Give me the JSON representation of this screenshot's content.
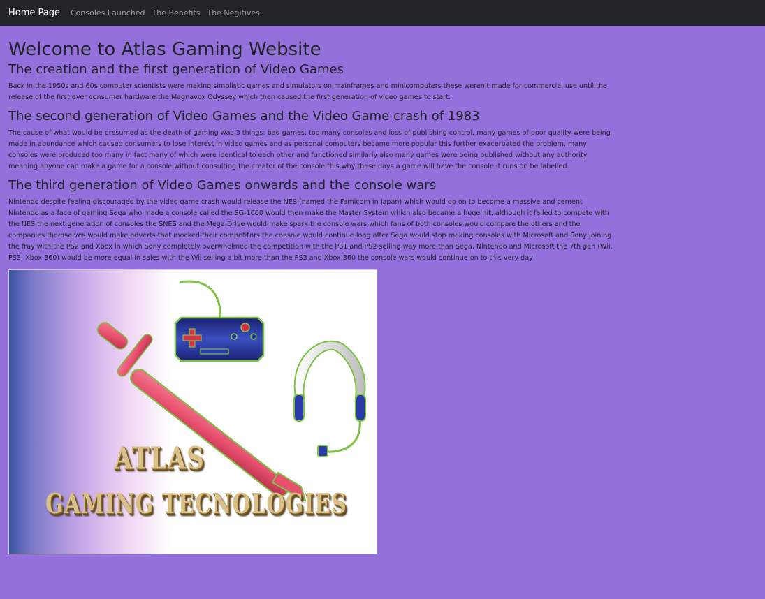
{
  "navbar": {
    "brand": "Home Page",
    "links": [
      "Consoles Launched",
      "The Benefits",
      "The Negitives"
    ]
  },
  "main": {
    "title": "Welcome to Atlas Gaming Website",
    "sections": [
      {
        "heading": "The creation and the first generation of Video Games",
        "body": "Back in the 1950s and 60s computer scientists were making simplistic games and simulators on mainframes and minicomputers these weren't made for commercial use until the release of the first ever consumer hardware the Magnavox Odyssey which then caused the first generation of video games to start."
      },
      {
        "heading": "The second generation of Video Games and the Video Game crash of 1983",
        "body": "The cause of what would be presumed as the death of gaming was 3 things: bad games, too many consoles and loss of publishing control, many games of poor quality were being made in abundance which caused consumers to lose interest in video games and as personal computers became more popular this further exacerbated the problem, many consoles were produced too many in fact many of which were identical to each other and functioned similarly also many games were being published without any authority meaning anyone can make a game for a console without consulting the creator of the console this why these days a game will have the console it runs on be labelled."
      },
      {
        "heading": "The third generation of Video Games onwards and the console wars",
        "body": "Nintendo despite feeling discouraged by the video game crash would release the NES (named the Famicom in Japan) which would go on to become a massive and cement Nintendo as a face of gaming Sega who made a console called the SG-1000 would then make the Master System which also became a huge hit, although it failed to compete with the NES the next generation of consoles the SNES and the Mega Drive would make spark the console wars which fans of both consoles would compare the others and the companies themselves would make adverts that mocked their competitors the console would continue long after Sega would stop making consoles with Microsoft and Sony joining the fray with the PS2 and Xbox in which Sony completely overwhelmed the competition with the PS1 and PS2 selling way more than Sega, Nintendo and Microsoft the 7th gen (Wii, PS3, Xbox 360) would be more equal in sales with the Wii selling a bit more than the PS3 and Xbox 360 the console wars would continue on to this very day"
      }
    ],
    "hero_logo": {
      "line1": "ATLAS",
      "line2": "GAMING TECNOLOGIES"
    }
  },
  "colors": {
    "page_background": "#9370db",
    "navbar_background": "#212529",
    "sword": "#e8506e",
    "outline": "#7cc243",
    "controller": "#1e2a8a"
  },
  "icons": [
    "sword-icon",
    "game-controller-icon",
    "headset-icon"
  ]
}
